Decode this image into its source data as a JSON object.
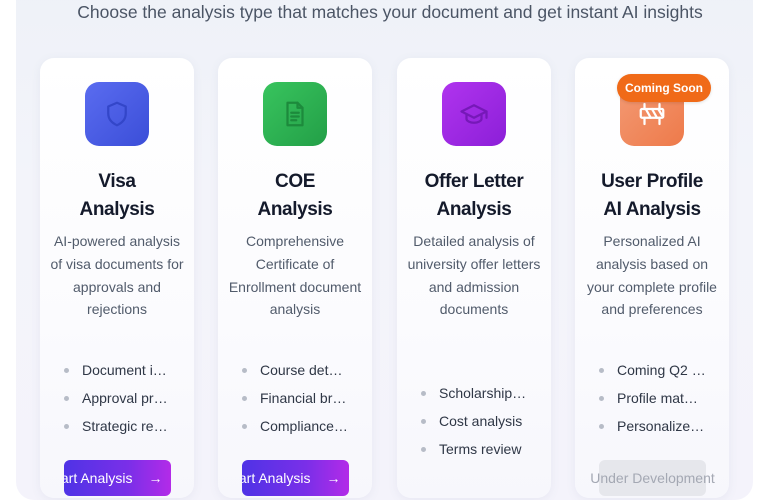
{
  "header": {
    "subtitle": "Choose the analysis type that matches your document and get instant AI insights"
  },
  "cards": [
    {
      "title_line1": "Visa",
      "title_line2": "Analysis",
      "icon": "shield-icon",
      "icon_color": "#4a5ae6",
      "description": "AI-powered analysis of visa documents for approvals and rejections",
      "features": [
        "Document i…",
        "Approval pr…",
        "Strategic re…"
      ],
      "button_label": "tart Analysis",
      "button_arrow": "→"
    },
    {
      "title_line1": "COE",
      "title_line2": "Analysis",
      "icon": "document-icon",
      "icon_color": "#2bb252",
      "description": "Comprehensive Certificate of Enrollment document analysis",
      "features": [
        "Course det…",
        "Financial br…",
        "Compliance…"
      ],
      "button_label": "tart Analysis",
      "button_arrow": "→"
    },
    {
      "title_line1": "Offer Letter",
      "title_line2": "Analysis",
      "icon": "graduation-cap-icon",
      "icon_color": "#a028e6",
      "description": "Detailed analysis of university offer letters and admission documents",
      "features": [
        "Scholarship…",
        "Cost analysis",
        "Terms review"
      ]
    },
    {
      "title_line1": "User Profile",
      "title_line2": "AI Analysis",
      "icon": "construction-barrier-icon",
      "icon_color": "#f1835a",
      "badge": "Coming Soon",
      "description": "Personalized AI analysis based on your complete profile and preferences",
      "features": [
        "Coming Q2 …",
        "Profile mat…",
        "Personalize…"
      ],
      "disabled_label": "Under Development"
    }
  ]
}
